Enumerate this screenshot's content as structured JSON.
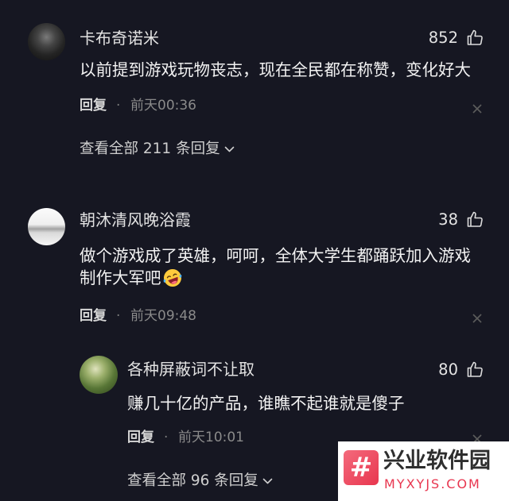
{
  "colors": {
    "background": "#161722",
    "text": "#f2f2f2",
    "muted": "#8a8a8a",
    "watermark_accent": "#e8364f"
  },
  "comments": [
    {
      "avatar_icon": "user-avatar-dark",
      "username": "卡布奇诺米",
      "likes": "852",
      "like_icon": "thumbs-up-icon",
      "body_lines": [
        "以前提到游戏玩物丧志，现在全民都在称赞，变化好大"
      ],
      "reply_label": "回复",
      "separator": "·",
      "time": "前天00:36",
      "close_icon": "close-icon",
      "view_replies": "查看全部 211 条回复",
      "view_icon": "chevron-down-icon"
    },
    {
      "avatar_icon": "user-avatar-landscape",
      "username": "朝沐清风晚浴霞",
      "likes": "38",
      "like_icon": "thumbs-up-icon",
      "body_lines": [
        "做个游戏成了英雄，呵呵，全体大学生都踊跃加入游戏",
        "制作大军吧"
      ],
      "emoji_icon": "laughing-emoji-icon",
      "reply_label": "回复",
      "separator": "·",
      "time": "前天09:48",
      "close_icon": "close-icon",
      "replies": [
        {
          "avatar_icon": "user-avatar-plants",
          "username": "各种屏蔽词不让取",
          "likes": "80",
          "like_icon": "thumbs-up-icon",
          "body_lines": [
            "赚几十亿的产品，谁瞧不起谁就是傻子"
          ],
          "reply_label": "回复",
          "separator": "·",
          "time": "前天10:01",
          "close_icon": "close-icon"
        }
      ],
      "view_replies": "查看全部 96 条回复",
      "view_icon": "chevron-down-icon"
    }
  ],
  "watermark": {
    "logo_glyph": "#",
    "title": "兴业软件园",
    "url": "MYXYJS.COM"
  }
}
